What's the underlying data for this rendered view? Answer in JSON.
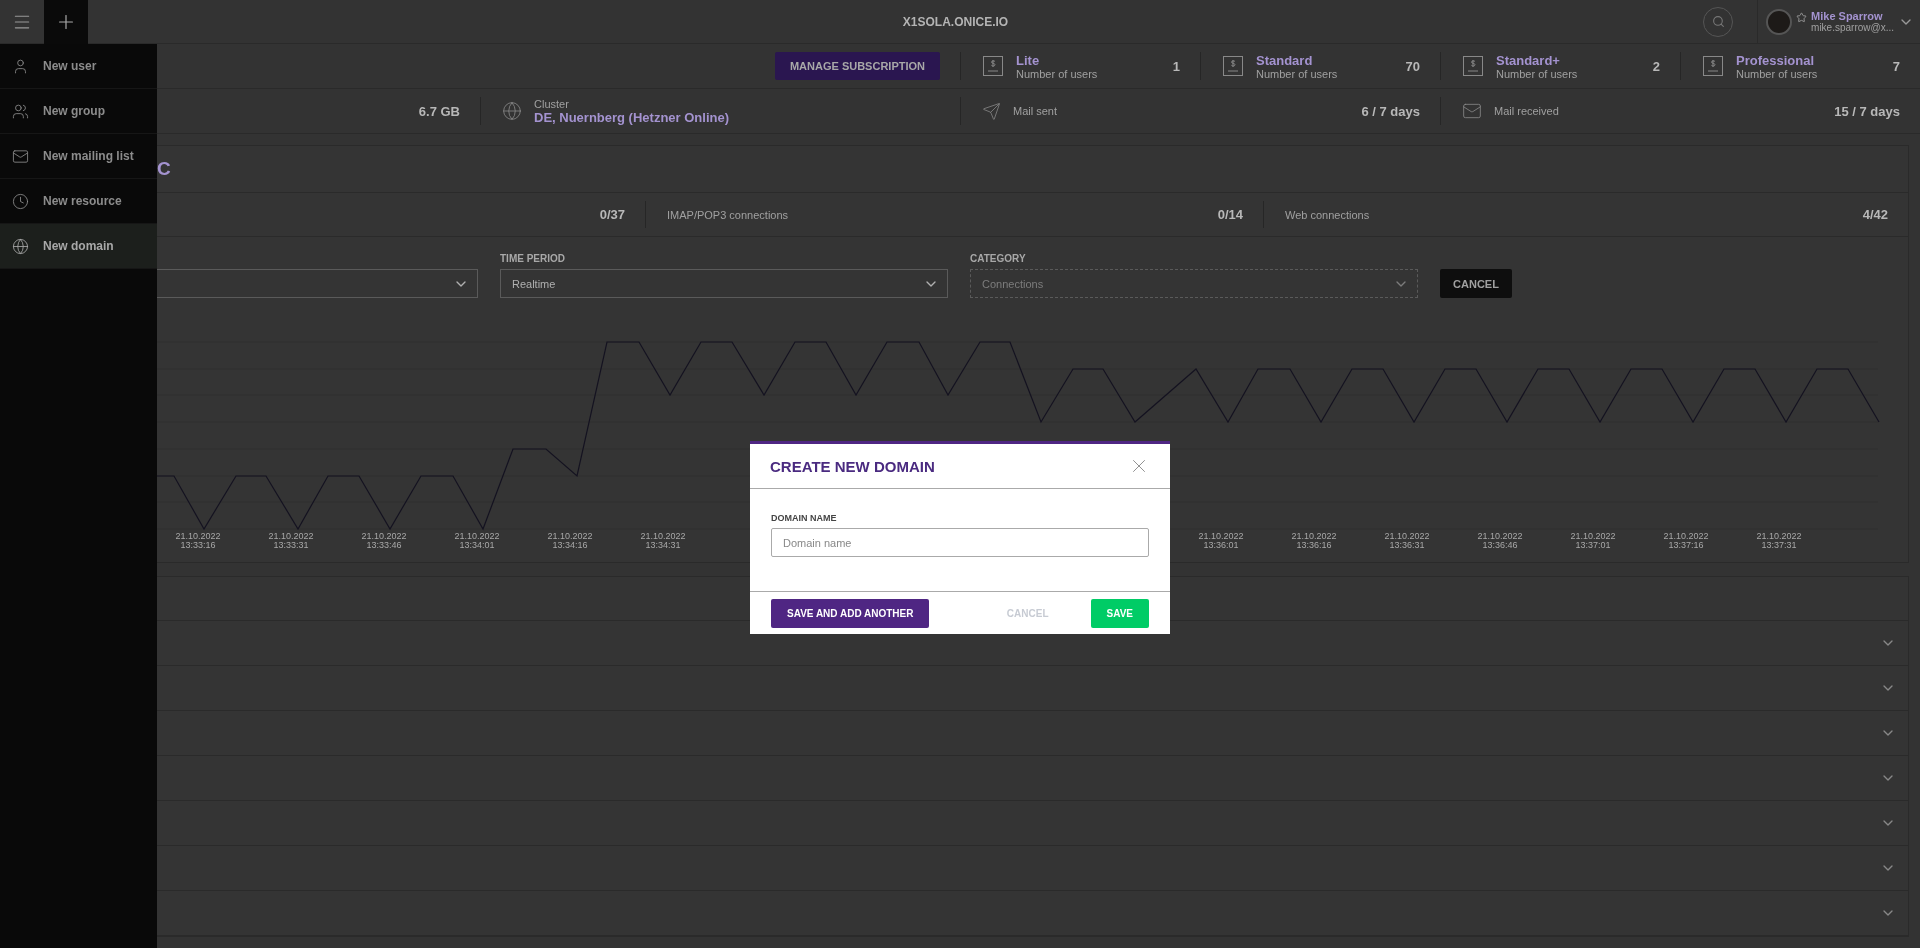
{
  "top_bar": {
    "title": "X1SOLA.ONICE.IO",
    "user": {
      "name": "Mike Sparrow",
      "email": "mike.sparrow@x..."
    }
  },
  "new_menu": [
    {
      "label": "New user",
      "kind": "user",
      "selected": false
    },
    {
      "label": "New group",
      "kind": "group",
      "selected": false
    },
    {
      "label": "New mailing list",
      "kind": "mail",
      "selected": false
    },
    {
      "label": "New resource",
      "kind": "resource",
      "selected": false
    },
    {
      "label": "New domain",
      "kind": "domain",
      "selected": true
    }
  ],
  "subscription": {
    "button": "MANAGE SUBSCRIPTION",
    "plans": [
      {
        "name": "Lite",
        "caption": "Number of users",
        "count": "1"
      },
      {
        "name": "Standard",
        "caption": "Number of users",
        "count": "70"
      },
      {
        "name": "Standard+",
        "caption": "Number of users",
        "count": "2"
      },
      {
        "name": "Professional",
        "caption": "Number of users",
        "count": "7"
      }
    ]
  },
  "usage": {
    "storage": "6.7 GB",
    "cluster": {
      "label": "Cluster",
      "value": "DE, Nuernberg (Hetzner Online)"
    },
    "mail": [
      {
        "kind": "sent",
        "label": "Mail sent",
        "value": "6 / 7 days"
      },
      {
        "kind": "received",
        "label": "Mail received",
        "value": "15 / 7 days"
      }
    ]
  },
  "stats_card": {
    "heading": "C",
    "connections": [
      {
        "value": "0/37"
      },
      {
        "label": "IMAP/POP3 connections",
        "value": "0/14"
      },
      {
        "label": "Web connections",
        "value": "4/42"
      }
    ],
    "filters": [
      {
        "label": "TIME PERIOD",
        "value": "Realtime",
        "disabled": false
      },
      {
        "label": "CATEGORY",
        "value": "Connections",
        "disabled": true
      }
    ],
    "cancel_button": "CANCEL",
    "chart_labels": [
      {
        "date": "21.10.2022",
        "time": "13:33:16"
      },
      {
        "date": "21.10.2022",
        "time": "13:33:31"
      },
      {
        "date": "21.10.2022",
        "time": "13:33:46"
      },
      {
        "date": "21.10.2022",
        "time": "13:34:01"
      },
      {
        "date": "21.10.2022",
        "time": "13:34:16"
      },
      {
        "date": "21.10.2022",
        "time": "13:34:31"
      },
      {
        "date": "21.10.2022",
        "time": "13:36:01"
      },
      {
        "date": "21.10.2022",
        "time": "13:36:16"
      },
      {
        "date": "21.10.2022",
        "time": "13:36:31"
      },
      {
        "date": "21.10.2022",
        "time": "13:36:46"
      },
      {
        "date": "21.10.2022",
        "time": "13:37:01"
      },
      {
        "date": "21.10.2022",
        "time": "13:37:16"
      },
      {
        "date": "21.10.2022",
        "time": "13:37:31"
      }
    ]
  },
  "accordion_rows": [
    {
      "expanded": false
    },
    {
      "expanded": false
    },
    {
      "expanded": false
    },
    {
      "expanded": false
    },
    {
      "expanded": false
    },
    {
      "expanded": false
    },
    {
      "expanded": false
    }
  ],
  "modal": {
    "title": "CREATE NEW DOMAIN",
    "field_label": "DOMAIN NAME",
    "placeholder": "Domain name",
    "buttons": [
      {
        "label": "SAVE AND ADD ANOTHER",
        "kind": "secondary"
      },
      {
        "label": "CANCEL",
        "kind": "text"
      },
      {
        "label": "SAVE",
        "kind": "primary"
      }
    ]
  }
}
